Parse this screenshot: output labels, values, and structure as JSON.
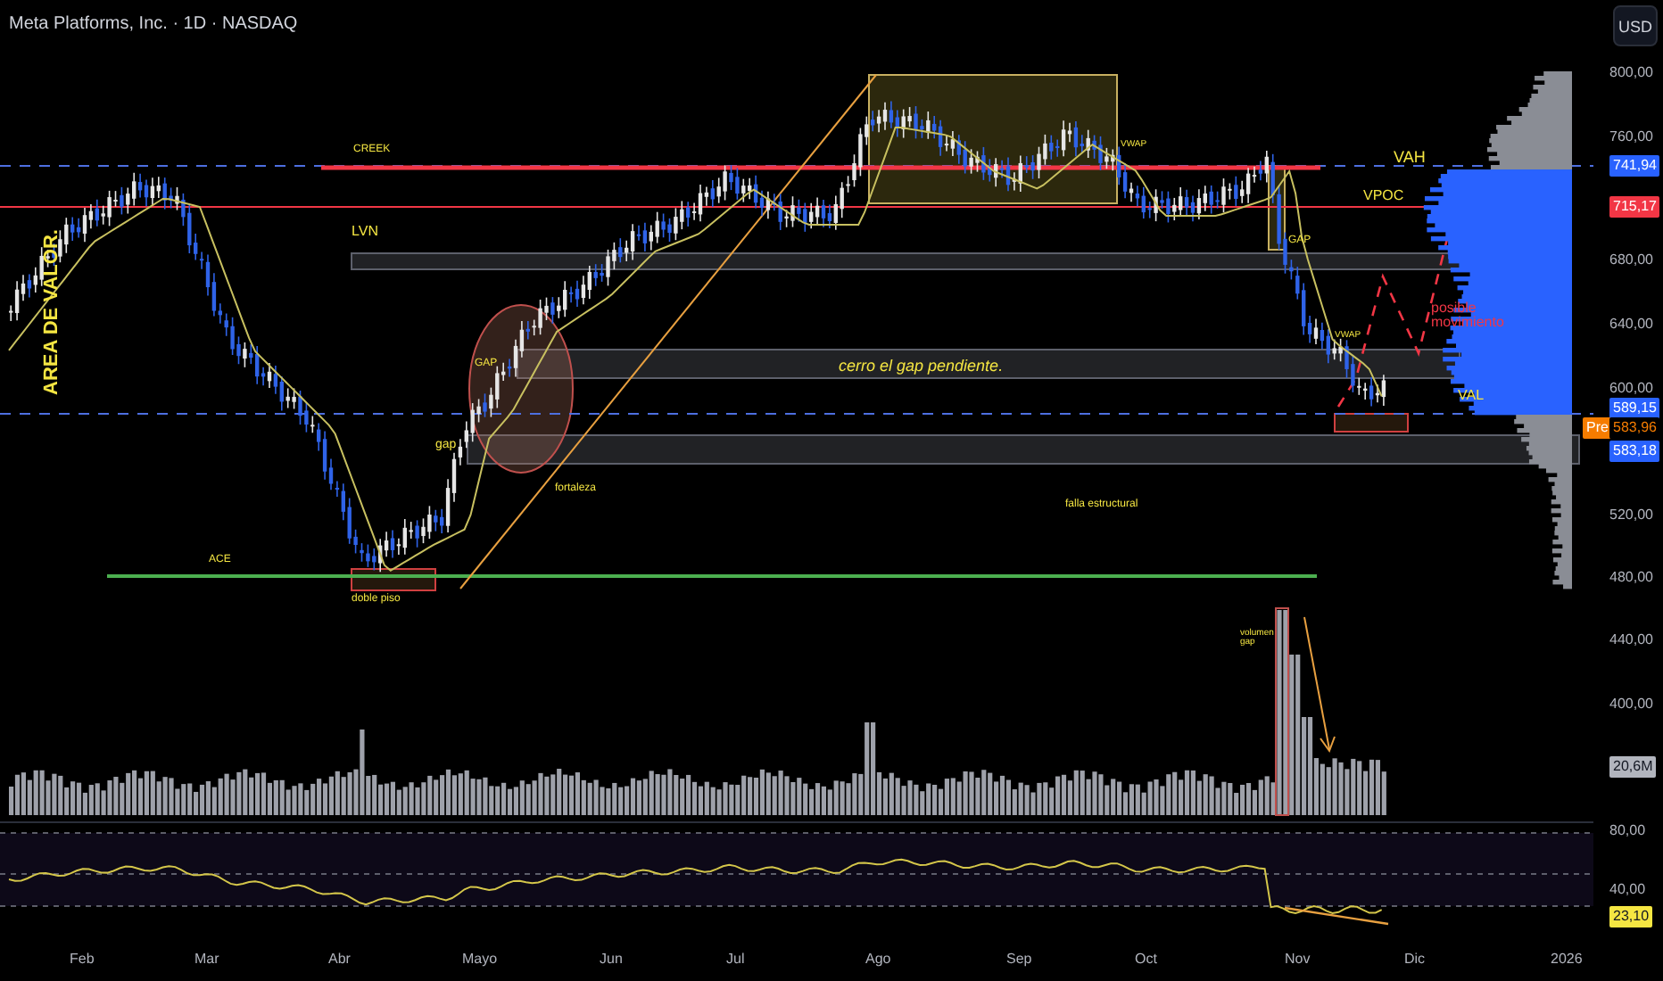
{
  "header": {
    "title": "Meta Platforms, Inc. · 1D · NASDAQ",
    "currency_button": "USD"
  },
  "price_axis": {
    "ticks": [
      "800,00",
      "760,00",
      "680,00",
      "640,00",
      "600,00",
      "520,00",
      "480,00",
      "440,00",
      "400,00"
    ]
  },
  "price_badges": [
    {
      "kind": "price",
      "label": "741,94",
      "color": "#2962ff"
    },
    {
      "kind": "price",
      "label": "715,17",
      "color": "#f23645"
    },
    {
      "kind": "price",
      "label": "589,15",
      "color": "#2962ff"
    },
    {
      "kind": "pre",
      "tag": "Pre",
      "label": "583,96",
      "color": "#f57c00"
    },
    {
      "kind": "price",
      "label": "583,18",
      "color": "#2962ff"
    }
  ],
  "volume_badge": "20,6M",
  "rsi_axis": {
    "ticks": [
      "80,00",
      "40,00"
    ],
    "badge": "23,10"
  },
  "time_axis": [
    "Feb",
    "Mar",
    "Abr",
    "Mayo",
    "Jun",
    "Jul",
    "Ago",
    "Sep",
    "Oct",
    "Nov",
    "Dic",
    "2026"
  ],
  "annotations": [
    {
      "kind": "vertical",
      "text": "AREA DE VALOR."
    },
    {
      "kind": "label",
      "text": "CREEK"
    },
    {
      "kind": "label",
      "text": "LVN"
    },
    {
      "kind": "label",
      "text": "VAH"
    },
    {
      "kind": "label",
      "text": "VPOC"
    },
    {
      "kind": "label",
      "text": "GAP"
    },
    {
      "kind": "label",
      "text": "VWAP"
    },
    {
      "kind": "label",
      "text": "VWAP"
    },
    {
      "kind": "projection",
      "text": "posible movimiento"
    },
    {
      "kind": "italic",
      "text": "cerro el gap pendiente."
    },
    {
      "kind": "label",
      "text": "VAL"
    },
    {
      "kind": "label",
      "text": "GAP"
    },
    {
      "kind": "label",
      "text": "gap"
    },
    {
      "kind": "label",
      "text": "fortaleza"
    },
    {
      "kind": "label",
      "text": "falla estructural"
    },
    {
      "kind": "label",
      "text": "ACE"
    },
    {
      "kind": "label",
      "text": "doble piso"
    },
    {
      "kind": "label",
      "text": "volumen gap"
    }
  ]
}
